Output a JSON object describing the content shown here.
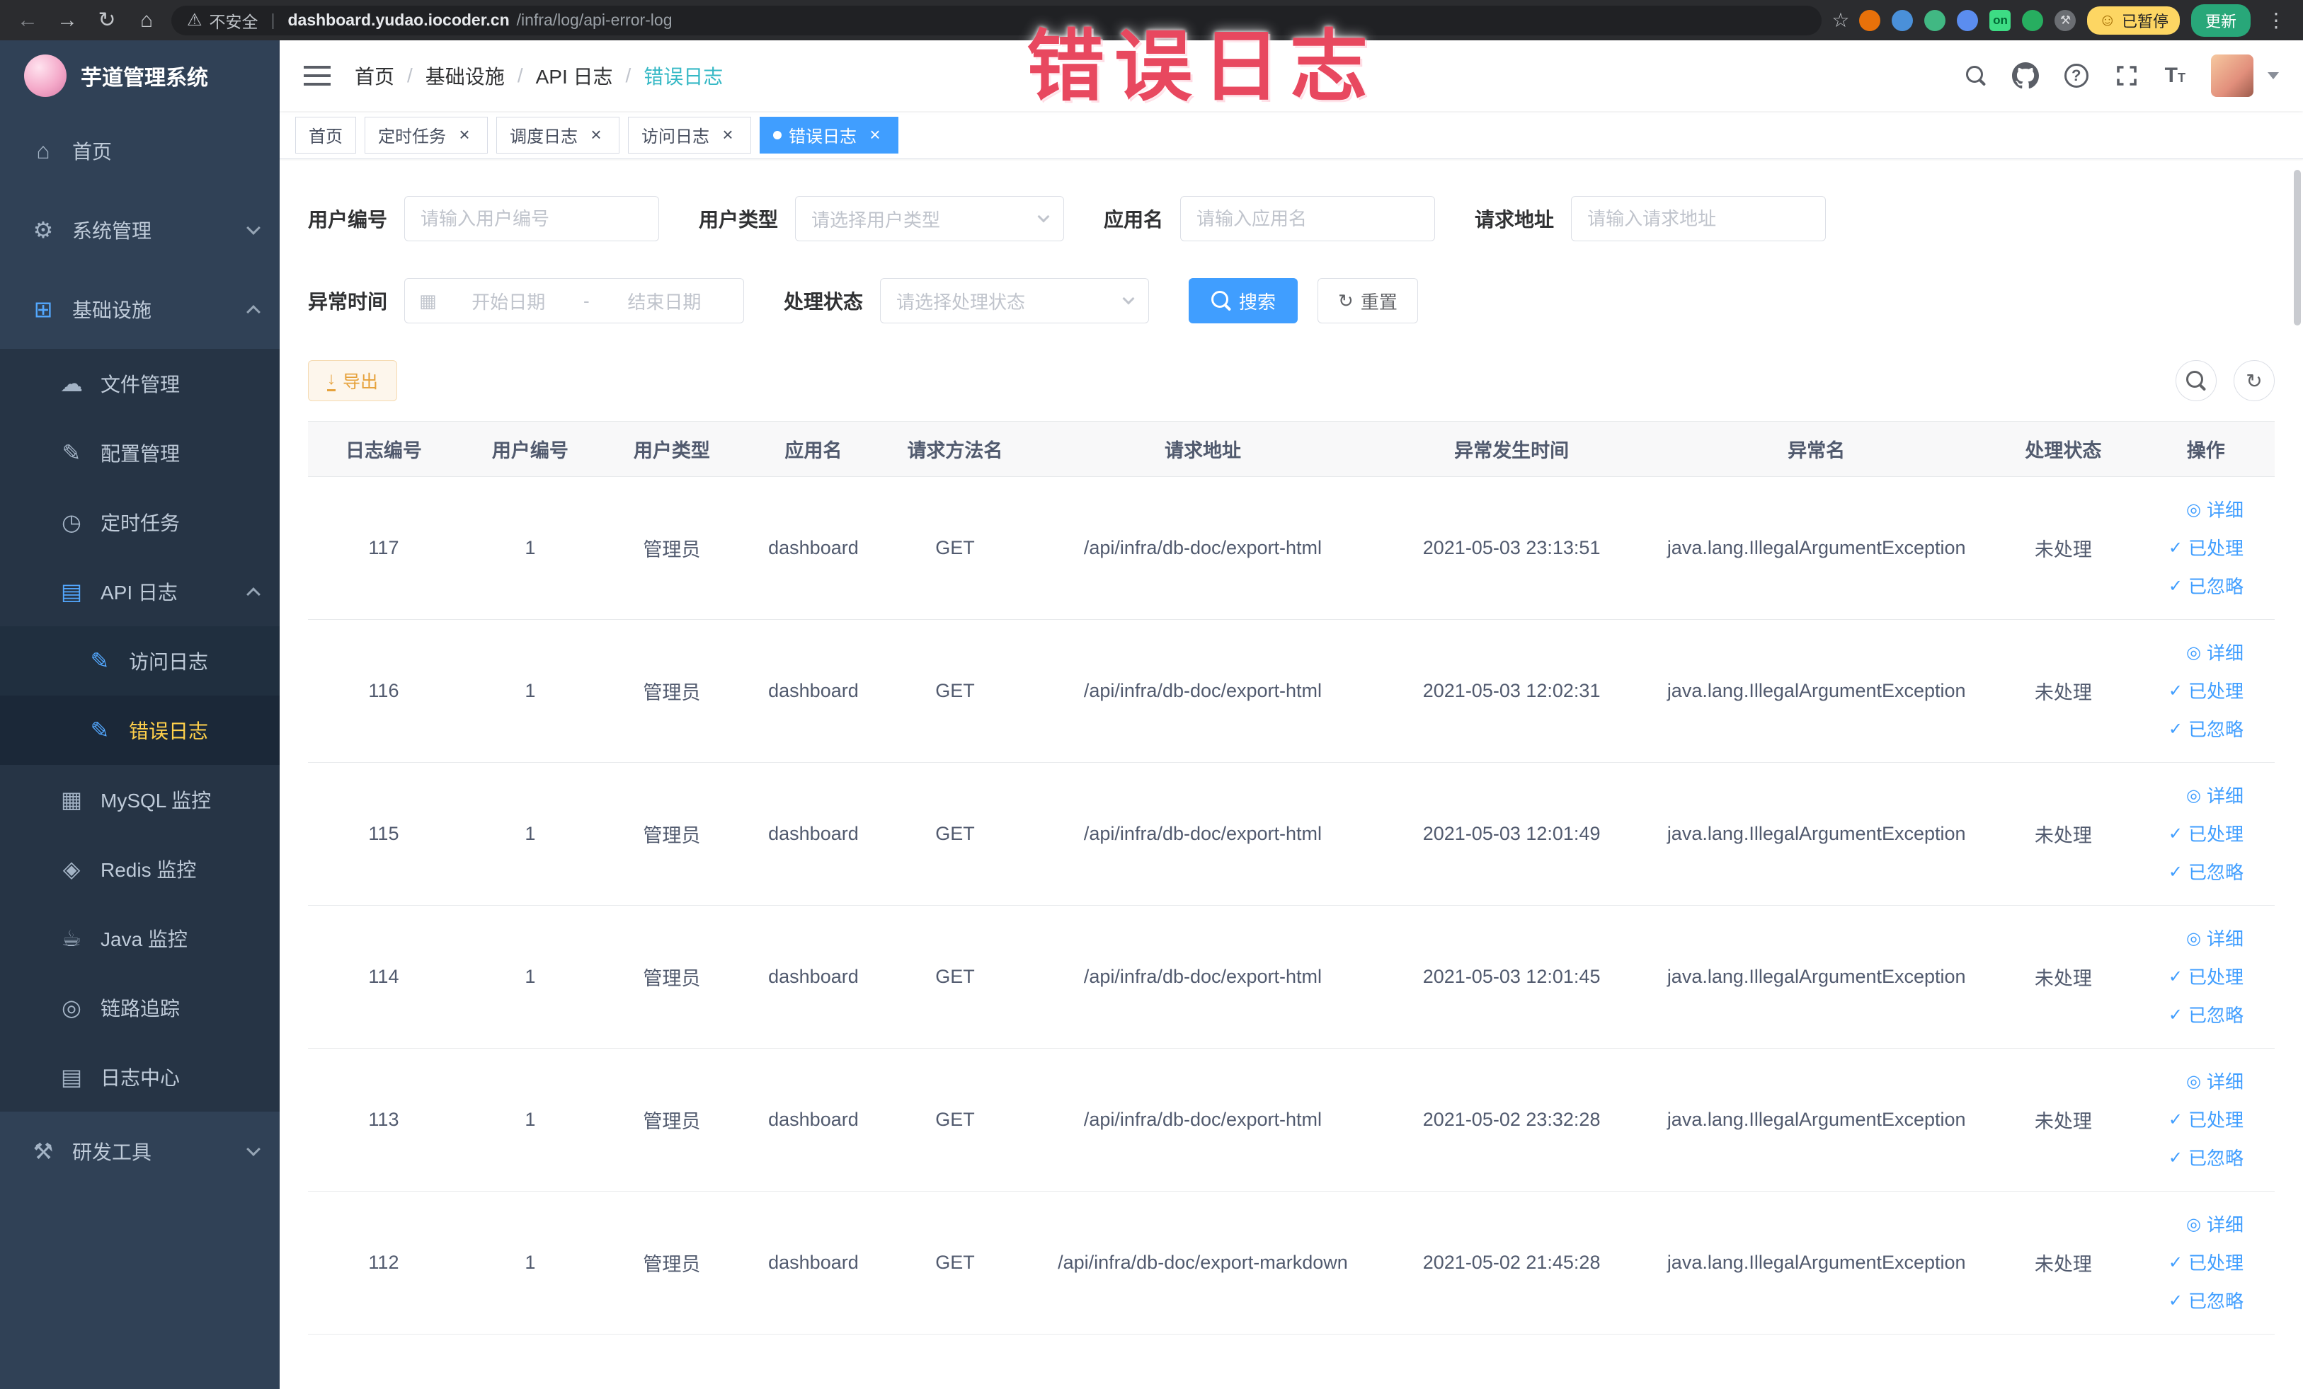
{
  "colors": {
    "primary": "#409eff",
    "menu_active_text": "#ffd04b",
    "warning": "#e6a23c",
    "annotation": "#e8485f",
    "breadcrumb_current": "#35b8c5",
    "sidebar_bg": "#304156"
  },
  "annotation": {
    "text": "错误日志"
  },
  "browser": {
    "security_label": "不安全",
    "url_host": "dashboard.yudao.iocoder.cn",
    "url_path": "/infra/log/api-error-log",
    "ext_on_label": "on",
    "paused_badge": "已暂停",
    "update_label": "更新"
  },
  "sidebar": {
    "title": "芋道管理系统",
    "items": [
      {
        "key": "home",
        "label": "首页",
        "level": 0,
        "icon": "home"
      },
      {
        "key": "system-mgmt",
        "label": "系统管理",
        "level": 0,
        "icon": "gear",
        "arrow": "down"
      },
      {
        "key": "infrastructure",
        "label": "基础设施",
        "level": 0,
        "icon": "infra",
        "arrow": "up",
        "icon_color": "#53a8ff"
      },
      {
        "key": "file-mgmt",
        "label": "文件管理",
        "level": 1,
        "icon": "cloud"
      },
      {
        "key": "config-mgmt",
        "label": "配置管理",
        "level": 1,
        "icon": "edit"
      },
      {
        "key": "cron-job",
        "label": "定时任务",
        "level": 1,
        "icon": "clock"
      },
      {
        "key": "api-log",
        "label": "API 日志",
        "level": 1,
        "icon": "doc",
        "arrow": "up",
        "icon_color": "#53a8ff"
      },
      {
        "key": "access-log",
        "label": "访问日志",
        "level": 2,
        "icon": "edit-doc",
        "icon_color": "#53a8ff"
      },
      {
        "key": "error-log",
        "label": "错误日志",
        "level": 2,
        "icon": "edit-doc",
        "icon_color": "#53a8ff",
        "active": true
      },
      {
        "key": "mysql-monitor",
        "label": "MySQL 监控",
        "level": 1,
        "icon": "database"
      },
      {
        "key": "redis-monitor",
        "label": "Redis 监控",
        "level": 1,
        "icon": "redis"
      },
      {
        "key": "java-monitor",
        "label": "Java 监控",
        "level": 1,
        "icon": "java"
      },
      {
        "key": "link-trace",
        "label": "链路追踪",
        "level": 1,
        "icon": "eye"
      },
      {
        "key": "log-center",
        "label": "日志中心",
        "level": 1,
        "icon": "doc"
      },
      {
        "key": "dev-tools",
        "label": "研发工具",
        "level": 0,
        "icon": "tools",
        "arrow": "down"
      }
    ]
  },
  "header": {
    "breadcrumb": [
      {
        "key": "home",
        "label": "首页"
      },
      {
        "key": "infrastructure",
        "label": "基础设施"
      },
      {
        "key": "api-log",
        "label": "API 日志"
      },
      {
        "key": "error-log",
        "label": "错误日志",
        "current": true
      }
    ]
  },
  "tabs": [
    {
      "key": "home",
      "label": "首页",
      "closable": false,
      "active": false
    },
    {
      "key": "cron-job",
      "label": "定时任务",
      "closable": true,
      "active": false
    },
    {
      "key": "schedule-log",
      "label": "调度日志",
      "closable": true,
      "active": false
    },
    {
      "key": "access-log",
      "label": "访问日志",
      "closable": true,
      "active": false
    },
    {
      "key": "error-log",
      "label": "错误日志",
      "closable": true,
      "active": true
    }
  ],
  "filters": {
    "user_id": {
      "label": "用户编号",
      "placeholder": "请输入用户编号"
    },
    "user_type": {
      "label": "用户类型",
      "placeholder": "请选择用户类型"
    },
    "app_name": {
      "label": "应用名",
      "placeholder": "请输入应用名"
    },
    "request_url": {
      "label": "请求地址",
      "placeholder": "请输入请求地址"
    },
    "exception_time": {
      "label": "异常时间",
      "start_placeholder": "开始日期",
      "separator": "-",
      "end_placeholder": "结束日期"
    },
    "process_status": {
      "label": "处理状态",
      "placeholder": "请选择处理状态"
    },
    "search_label": "搜索",
    "reset_label": "重置"
  },
  "toolbar": {
    "export_label": "导出"
  },
  "table": {
    "headers": [
      "日志编号",
      "用户编号",
      "用户类型",
      "应用名",
      "请求方法名",
      "请求地址",
      "异常发生时间",
      "异常名",
      "处理状态",
      "操作"
    ],
    "action_labels": {
      "detail": "详细",
      "processed": "已处理",
      "ignored": "已忽略"
    },
    "rows": [
      {
        "id": "117",
        "user_id": "1",
        "user_type": "管理员",
        "app": "dashboard",
        "method": "GET",
        "url": "/api/infra/db-doc/export-html",
        "time": "2021-05-03 23:13:51",
        "exception": "java.lang.IllegalArgumentException",
        "status": "未处理"
      },
      {
        "id": "116",
        "user_id": "1",
        "user_type": "管理员",
        "app": "dashboard",
        "method": "GET",
        "url": "/api/infra/db-doc/export-html",
        "time": "2021-05-03 12:02:31",
        "exception": "java.lang.IllegalArgumentException",
        "status": "未处理"
      },
      {
        "id": "115",
        "user_id": "1",
        "user_type": "管理员",
        "app": "dashboard",
        "method": "GET",
        "url": "/api/infra/db-doc/export-html",
        "time": "2021-05-03 12:01:49",
        "exception": "java.lang.IllegalArgumentException",
        "status": "未处理"
      },
      {
        "id": "114",
        "user_id": "1",
        "user_type": "管理员",
        "app": "dashboard",
        "method": "GET",
        "url": "/api/infra/db-doc/export-html",
        "time": "2021-05-03 12:01:45",
        "exception": "java.lang.IllegalArgumentException",
        "status": "未处理"
      },
      {
        "id": "113",
        "user_id": "1",
        "user_type": "管理员",
        "app": "dashboard",
        "method": "GET",
        "url": "/api/infra/db-doc/export-html",
        "time": "2021-05-02 23:32:28",
        "exception": "java.lang.IllegalArgumentException",
        "status": "未处理"
      },
      {
        "id": "112",
        "user_id": "1",
        "user_type": "管理员",
        "app": "dashboard",
        "method": "GET",
        "url": "/api/infra/db-doc/export-markdown",
        "time": "2021-05-02 21:45:28",
        "exception": "java.lang.IllegalArgumentException",
        "status": "未处理"
      }
    ]
  }
}
